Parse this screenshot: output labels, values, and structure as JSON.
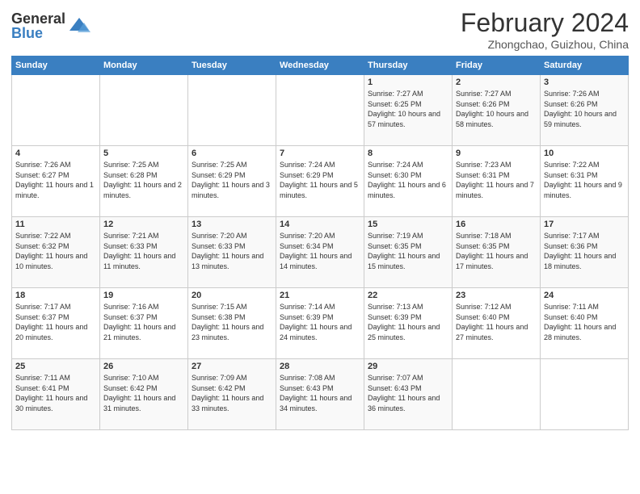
{
  "logo": {
    "general": "General",
    "blue": "Blue"
  },
  "title": "February 2024",
  "subtitle": "Zhongchao, Guizhou, China",
  "days_of_week": [
    "Sunday",
    "Monday",
    "Tuesday",
    "Wednesday",
    "Thursday",
    "Friday",
    "Saturday"
  ],
  "weeks": [
    [
      {
        "day": "",
        "info": ""
      },
      {
        "day": "",
        "info": ""
      },
      {
        "day": "",
        "info": ""
      },
      {
        "day": "",
        "info": ""
      },
      {
        "day": "1",
        "info": "Sunrise: 7:27 AM\nSunset: 6:25 PM\nDaylight: 10 hours and 57 minutes."
      },
      {
        "day": "2",
        "info": "Sunrise: 7:27 AM\nSunset: 6:26 PM\nDaylight: 10 hours and 58 minutes."
      },
      {
        "day": "3",
        "info": "Sunrise: 7:26 AM\nSunset: 6:26 PM\nDaylight: 10 hours and 59 minutes."
      }
    ],
    [
      {
        "day": "4",
        "info": "Sunrise: 7:26 AM\nSunset: 6:27 PM\nDaylight: 11 hours and 1 minute."
      },
      {
        "day": "5",
        "info": "Sunrise: 7:25 AM\nSunset: 6:28 PM\nDaylight: 11 hours and 2 minutes."
      },
      {
        "day": "6",
        "info": "Sunrise: 7:25 AM\nSunset: 6:29 PM\nDaylight: 11 hours and 3 minutes."
      },
      {
        "day": "7",
        "info": "Sunrise: 7:24 AM\nSunset: 6:29 PM\nDaylight: 11 hours and 5 minutes."
      },
      {
        "day": "8",
        "info": "Sunrise: 7:24 AM\nSunset: 6:30 PM\nDaylight: 11 hours and 6 minutes."
      },
      {
        "day": "9",
        "info": "Sunrise: 7:23 AM\nSunset: 6:31 PM\nDaylight: 11 hours and 7 minutes."
      },
      {
        "day": "10",
        "info": "Sunrise: 7:22 AM\nSunset: 6:31 PM\nDaylight: 11 hours and 9 minutes."
      }
    ],
    [
      {
        "day": "11",
        "info": "Sunrise: 7:22 AM\nSunset: 6:32 PM\nDaylight: 11 hours and 10 minutes."
      },
      {
        "day": "12",
        "info": "Sunrise: 7:21 AM\nSunset: 6:33 PM\nDaylight: 11 hours and 11 minutes."
      },
      {
        "day": "13",
        "info": "Sunrise: 7:20 AM\nSunset: 6:33 PM\nDaylight: 11 hours and 13 minutes."
      },
      {
        "day": "14",
        "info": "Sunrise: 7:20 AM\nSunset: 6:34 PM\nDaylight: 11 hours and 14 minutes."
      },
      {
        "day": "15",
        "info": "Sunrise: 7:19 AM\nSunset: 6:35 PM\nDaylight: 11 hours and 15 minutes."
      },
      {
        "day": "16",
        "info": "Sunrise: 7:18 AM\nSunset: 6:35 PM\nDaylight: 11 hours and 17 minutes."
      },
      {
        "day": "17",
        "info": "Sunrise: 7:17 AM\nSunset: 6:36 PM\nDaylight: 11 hours and 18 minutes."
      }
    ],
    [
      {
        "day": "18",
        "info": "Sunrise: 7:17 AM\nSunset: 6:37 PM\nDaylight: 11 hours and 20 minutes."
      },
      {
        "day": "19",
        "info": "Sunrise: 7:16 AM\nSunset: 6:37 PM\nDaylight: 11 hours and 21 minutes."
      },
      {
        "day": "20",
        "info": "Sunrise: 7:15 AM\nSunset: 6:38 PM\nDaylight: 11 hours and 23 minutes."
      },
      {
        "day": "21",
        "info": "Sunrise: 7:14 AM\nSunset: 6:39 PM\nDaylight: 11 hours and 24 minutes."
      },
      {
        "day": "22",
        "info": "Sunrise: 7:13 AM\nSunset: 6:39 PM\nDaylight: 11 hours and 25 minutes."
      },
      {
        "day": "23",
        "info": "Sunrise: 7:12 AM\nSunset: 6:40 PM\nDaylight: 11 hours and 27 minutes."
      },
      {
        "day": "24",
        "info": "Sunrise: 7:11 AM\nSunset: 6:40 PM\nDaylight: 11 hours and 28 minutes."
      }
    ],
    [
      {
        "day": "25",
        "info": "Sunrise: 7:11 AM\nSunset: 6:41 PM\nDaylight: 11 hours and 30 minutes."
      },
      {
        "day": "26",
        "info": "Sunrise: 7:10 AM\nSunset: 6:42 PM\nDaylight: 11 hours and 31 minutes."
      },
      {
        "day": "27",
        "info": "Sunrise: 7:09 AM\nSunset: 6:42 PM\nDaylight: 11 hours and 33 minutes."
      },
      {
        "day": "28",
        "info": "Sunrise: 7:08 AM\nSunset: 6:43 PM\nDaylight: 11 hours and 34 minutes."
      },
      {
        "day": "29",
        "info": "Sunrise: 7:07 AM\nSunset: 6:43 PM\nDaylight: 11 hours and 36 minutes."
      },
      {
        "day": "",
        "info": ""
      },
      {
        "day": "",
        "info": ""
      }
    ]
  ]
}
